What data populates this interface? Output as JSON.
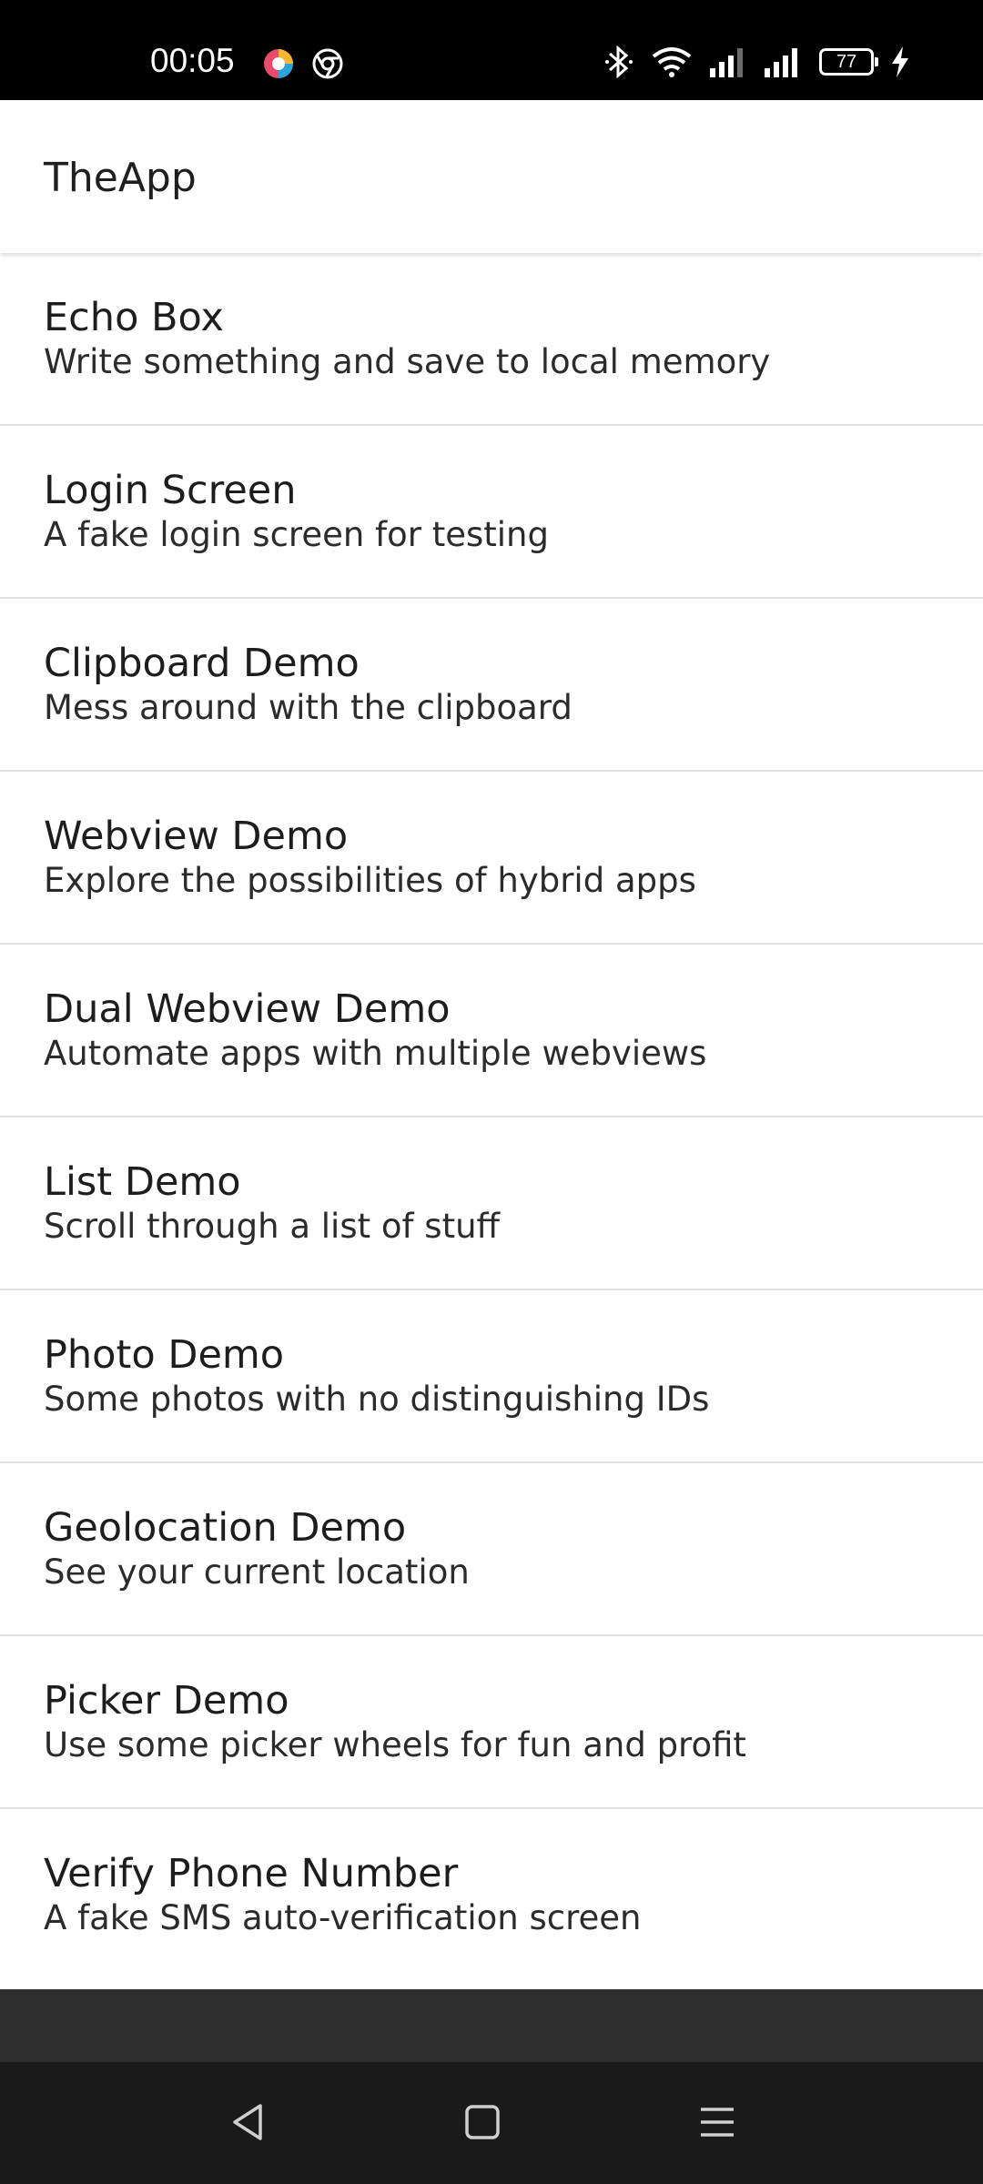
{
  "status_bar": {
    "time": "00:05",
    "battery_level": "77",
    "notification_icons": [
      "color-circle-app-icon",
      "chrome-icon"
    ],
    "system_icons": [
      "bluetooth-icon",
      "wifi-icon",
      "signal-icon",
      "signal-icon",
      "battery-icon",
      "charging-icon"
    ]
  },
  "app_bar": {
    "title": "TheApp"
  },
  "menu": {
    "items": [
      {
        "title": "Echo Box",
        "subtitle": "Write something and save to local memory"
      },
      {
        "title": "Login Screen",
        "subtitle": "A fake login screen for testing"
      },
      {
        "title": "Clipboard Demo",
        "subtitle": "Mess around with the clipboard"
      },
      {
        "title": "Webview Demo",
        "subtitle": "Explore the possibilities of hybrid apps"
      },
      {
        "title": "Dual Webview Demo",
        "subtitle": "Automate apps with multiple webviews"
      },
      {
        "title": "List Demo",
        "subtitle": "Scroll through a list of stuff"
      },
      {
        "title": "Photo Demo",
        "subtitle": "Some photos with no distinguishing IDs"
      },
      {
        "title": "Geolocation Demo",
        "subtitle": "See your current location"
      },
      {
        "title": "Picker Demo",
        "subtitle": "Use some picker wheels for fun and profit"
      },
      {
        "title": "Verify Phone Number",
        "subtitle": "A fake SMS auto-verification screen"
      }
    ]
  },
  "nav_bar": {
    "icons": [
      "back-icon",
      "home-icon",
      "recents-icon"
    ]
  },
  "colors": {
    "status_bar_bg": "#000000",
    "app_bar_bg": "#ffffff",
    "divider": "#e3e3e3",
    "bottom_strip": "#2d2d2d",
    "nav_bar_bg": "#1a1a1a"
  }
}
